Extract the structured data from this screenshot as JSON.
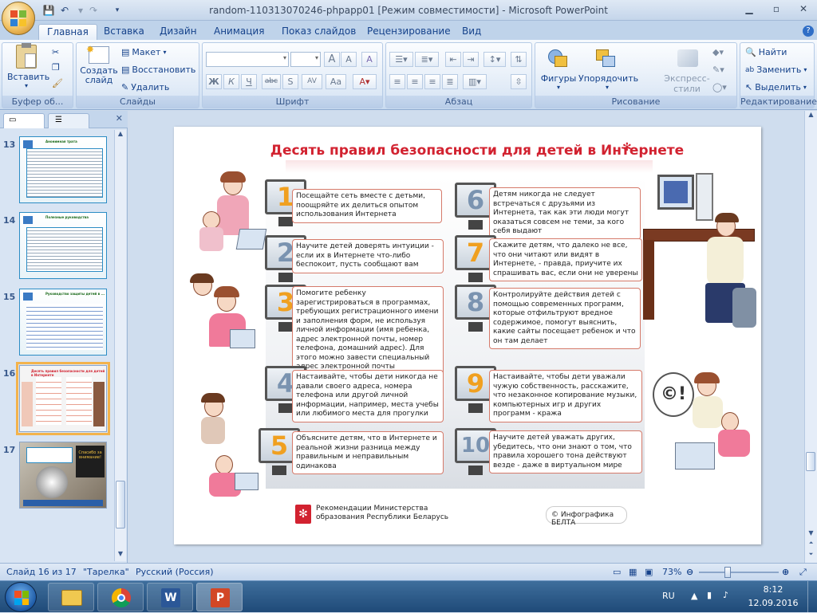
{
  "window": {
    "title": "random-110313070246-phpapp01 [Режим совместимости] - Microsoft PowerPoint"
  },
  "tabs": [
    "Главная",
    "Вставка",
    "Дизайн",
    "Анимация",
    "Показ слайдов",
    "Рецензирование",
    "Вид"
  ],
  "ribbon": {
    "clipboard": {
      "paste": "Вставить",
      "label": "Буфер об..."
    },
    "slides": {
      "new_slide": "Создать слайд",
      "layout": "Макет",
      "reset": "Восстановить",
      "delete": "Удалить",
      "label": "Слайды"
    },
    "font": {
      "label": "Шрифт",
      "bold": "Ж",
      "italic": "К",
      "underline": "Ч",
      "strike": "abc",
      "shadow": "S",
      "spacing": "AV",
      "case": "Aa",
      "grow": "A",
      "shrink": "A",
      "clear": "A"
    },
    "paragraph": {
      "label": "Абзац"
    },
    "drawing": {
      "shapes": "Фигуры",
      "arrange": "Упорядочить",
      "styles": "Экспресс-стили",
      "label": "Рисование"
    },
    "editing": {
      "find": "Найти",
      "replace": "Заменить",
      "select": "Выделить",
      "label": "Редактирование"
    }
  },
  "slides_panel": {
    "thumbnails": [
      {
        "num": "13",
        "title": "Анонимная трата"
      },
      {
        "num": "14",
        "title": "Полезные руководства"
      },
      {
        "num": "15",
        "title": "Руководство защиты детей в ..."
      },
      {
        "num": "16",
        "title": "Десять правил безопасности для детей в Интернете"
      },
      {
        "num": "17",
        "title": "Спасибо за внимание!"
      }
    ],
    "selected": "16"
  },
  "slide": {
    "title": "Десять правил безопасности для детей в Интернете",
    "rules": [
      {
        "num": "1",
        "text": "Посещайте сеть вместе с детьми, поощряйте их делиться опытом использования Интернета"
      },
      {
        "num": "2",
        "text": "Научите детей доверять интуиции - если их в Интернете что-либо беспокоит, пусть сообщают вам"
      },
      {
        "num": "3",
        "text": "Помогите ребенку зарегистрироваться в программах, требующих регистрационного имени и заполнения форм, не используя личной информации (имя ребенка, адрес электронной почты, номер телефона, домашний адрес). Для этого можно завести специальный адрес электронной почты"
      },
      {
        "num": "4",
        "text": "Настаивайте, чтобы дети никогда не давали своего адреса, номера телефона или другой личной информации, например, места учебы или любимого места для прогулки"
      },
      {
        "num": "5",
        "text": "Объясните детям, что в Интернете и реальной жизни разница между правильным и неправильным одинакова"
      },
      {
        "num": "6",
        "text": "Детям никогда не следует встречаться с друзьями из Интернета, так как эти люди могут оказаться совсем не теми, за кого себя выдают"
      },
      {
        "num": "7",
        "text": "Скажите детям, что далеко не все, что они читают или видят в Интернете, - правда, приучите их спрашивать вас, если они не уверены"
      },
      {
        "num": "8",
        "text": "Контролируйте действия детей с помощью современных программ, которые отфильтруют вредное содержимое, помогут выяснить, какие сайты посещает ребенок и что он там делает"
      },
      {
        "num": "9",
        "text": "Настаивайте, чтобы дети уважали чужую собственность, расскажите, что незаконное копирование музыки, компьютерных игр и других программ - кража"
      },
      {
        "num": "10",
        "text": "Научите детей уважать других, убедитесь, что они знают о том, что правила хорошего тона действуют везде - даже в виртуальном мире"
      }
    ],
    "footer_left": "Рекомендации Министерства образования Республики Беларусь",
    "footer_right": "© Инфографика БЕЛТА"
  },
  "status": {
    "slide_counter": "Слайд 16 из 17",
    "theme": "\"Тарелка\"",
    "language": "Русский (Россия)",
    "zoom": "73%"
  },
  "taskbar": {
    "lang": "RU",
    "time": "8:12",
    "date": "12.09.2016"
  }
}
